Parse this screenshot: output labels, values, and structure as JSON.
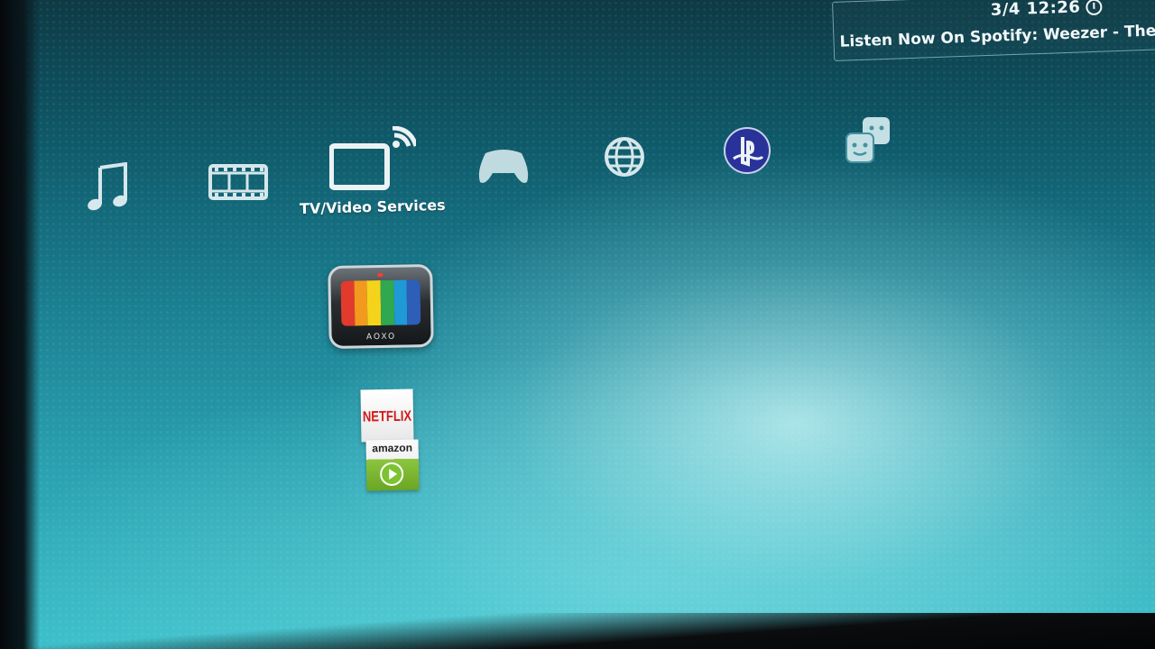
{
  "status_bar": {
    "clock": "3/4 12:26",
    "clock_icon": "clock-icon",
    "now_playing": "Listen Now On Spotify: Weezer - The Wh"
  },
  "xmb": {
    "categories": [
      {
        "id": "music",
        "icon": "music-note-icon",
        "label": ""
      },
      {
        "id": "video",
        "icon": "film-strip-icon",
        "label": ""
      },
      {
        "id": "tv",
        "icon": "tv-broadcast-icon",
        "label": "TV/Video Services",
        "selected": true
      },
      {
        "id": "game",
        "icon": "gamepad-icon",
        "label": ""
      },
      {
        "id": "network",
        "icon": "globe-icon",
        "label": ""
      },
      {
        "id": "psn",
        "icon": "playstation-network-icon",
        "label": ""
      },
      {
        "id": "friends",
        "icon": "friends-icon",
        "label": ""
      }
    ],
    "tv_items": [
      {
        "id": "tv-video-app",
        "icon": "tv-color-bars-icon",
        "brand": "AOXO"
      },
      {
        "id": "netflix",
        "icon": "netflix-icon",
        "label": "NETFLIX"
      },
      {
        "id": "amazon",
        "icon": "amazon-video-icon",
        "label": "amazon"
      }
    ]
  },
  "colors": {
    "color_bars": [
      "#e23b2e",
      "#f29a1d",
      "#f5d31b",
      "#2fa84f",
      "#1f9ad6",
      "#2d5fb8"
    ],
    "psn_blue": "#2b2f9e"
  }
}
